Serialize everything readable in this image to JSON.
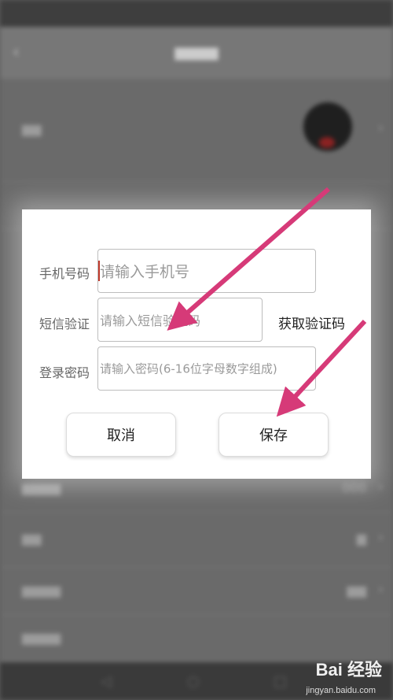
{
  "dialog": {
    "phone_label": "手机号码",
    "phone_placeholder": "请输入手机号",
    "sms_label": "短信验证",
    "sms_placeholder": "请输入短信验证码",
    "get_code_label": "获取验证码",
    "password_label": "登录密码",
    "password_placeholder": "请输入密码(6-16位字母数字组成)",
    "cancel_label": "取消",
    "save_label": "保存"
  },
  "background": {
    "partial_value": "000"
  },
  "watermark": {
    "brand": "Bai 经验",
    "url": "jingyan.baidu.com"
  },
  "colors": {
    "arrow": "#d63a78",
    "caret": "#c0392b"
  }
}
